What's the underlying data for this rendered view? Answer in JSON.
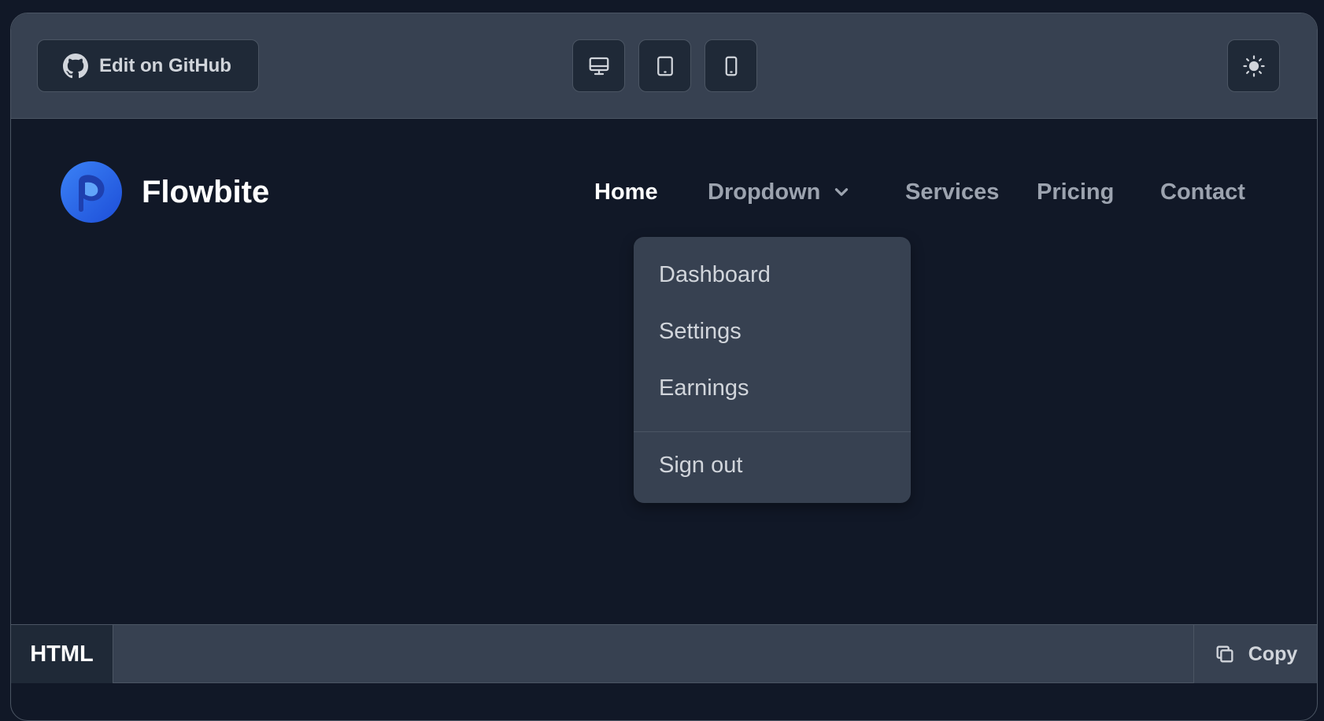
{
  "toolbar": {
    "github_label": "Edit on GitHub",
    "view_buttons": [
      "desktop",
      "tablet",
      "mobile"
    ],
    "theme_toggle": "sun-icon"
  },
  "navbar": {
    "brand": "Flowbite",
    "items": {
      "home": "Home",
      "dropdown": "Dropdown",
      "services": "Services",
      "pricing": "Pricing",
      "contact": "Contact"
    },
    "active": "Home"
  },
  "dropdown_menu": {
    "items": [
      "Dashboard",
      "Settings",
      "Earnings"
    ],
    "footer_item": "Sign out"
  },
  "codebar": {
    "tab": "HTML",
    "copy_label": "Copy"
  },
  "colors": {
    "background": "#111827",
    "toolbar": "#374151",
    "active_text": "#ffffff",
    "muted_text": "#9ca3af",
    "brand_blue": "#2563eb"
  }
}
